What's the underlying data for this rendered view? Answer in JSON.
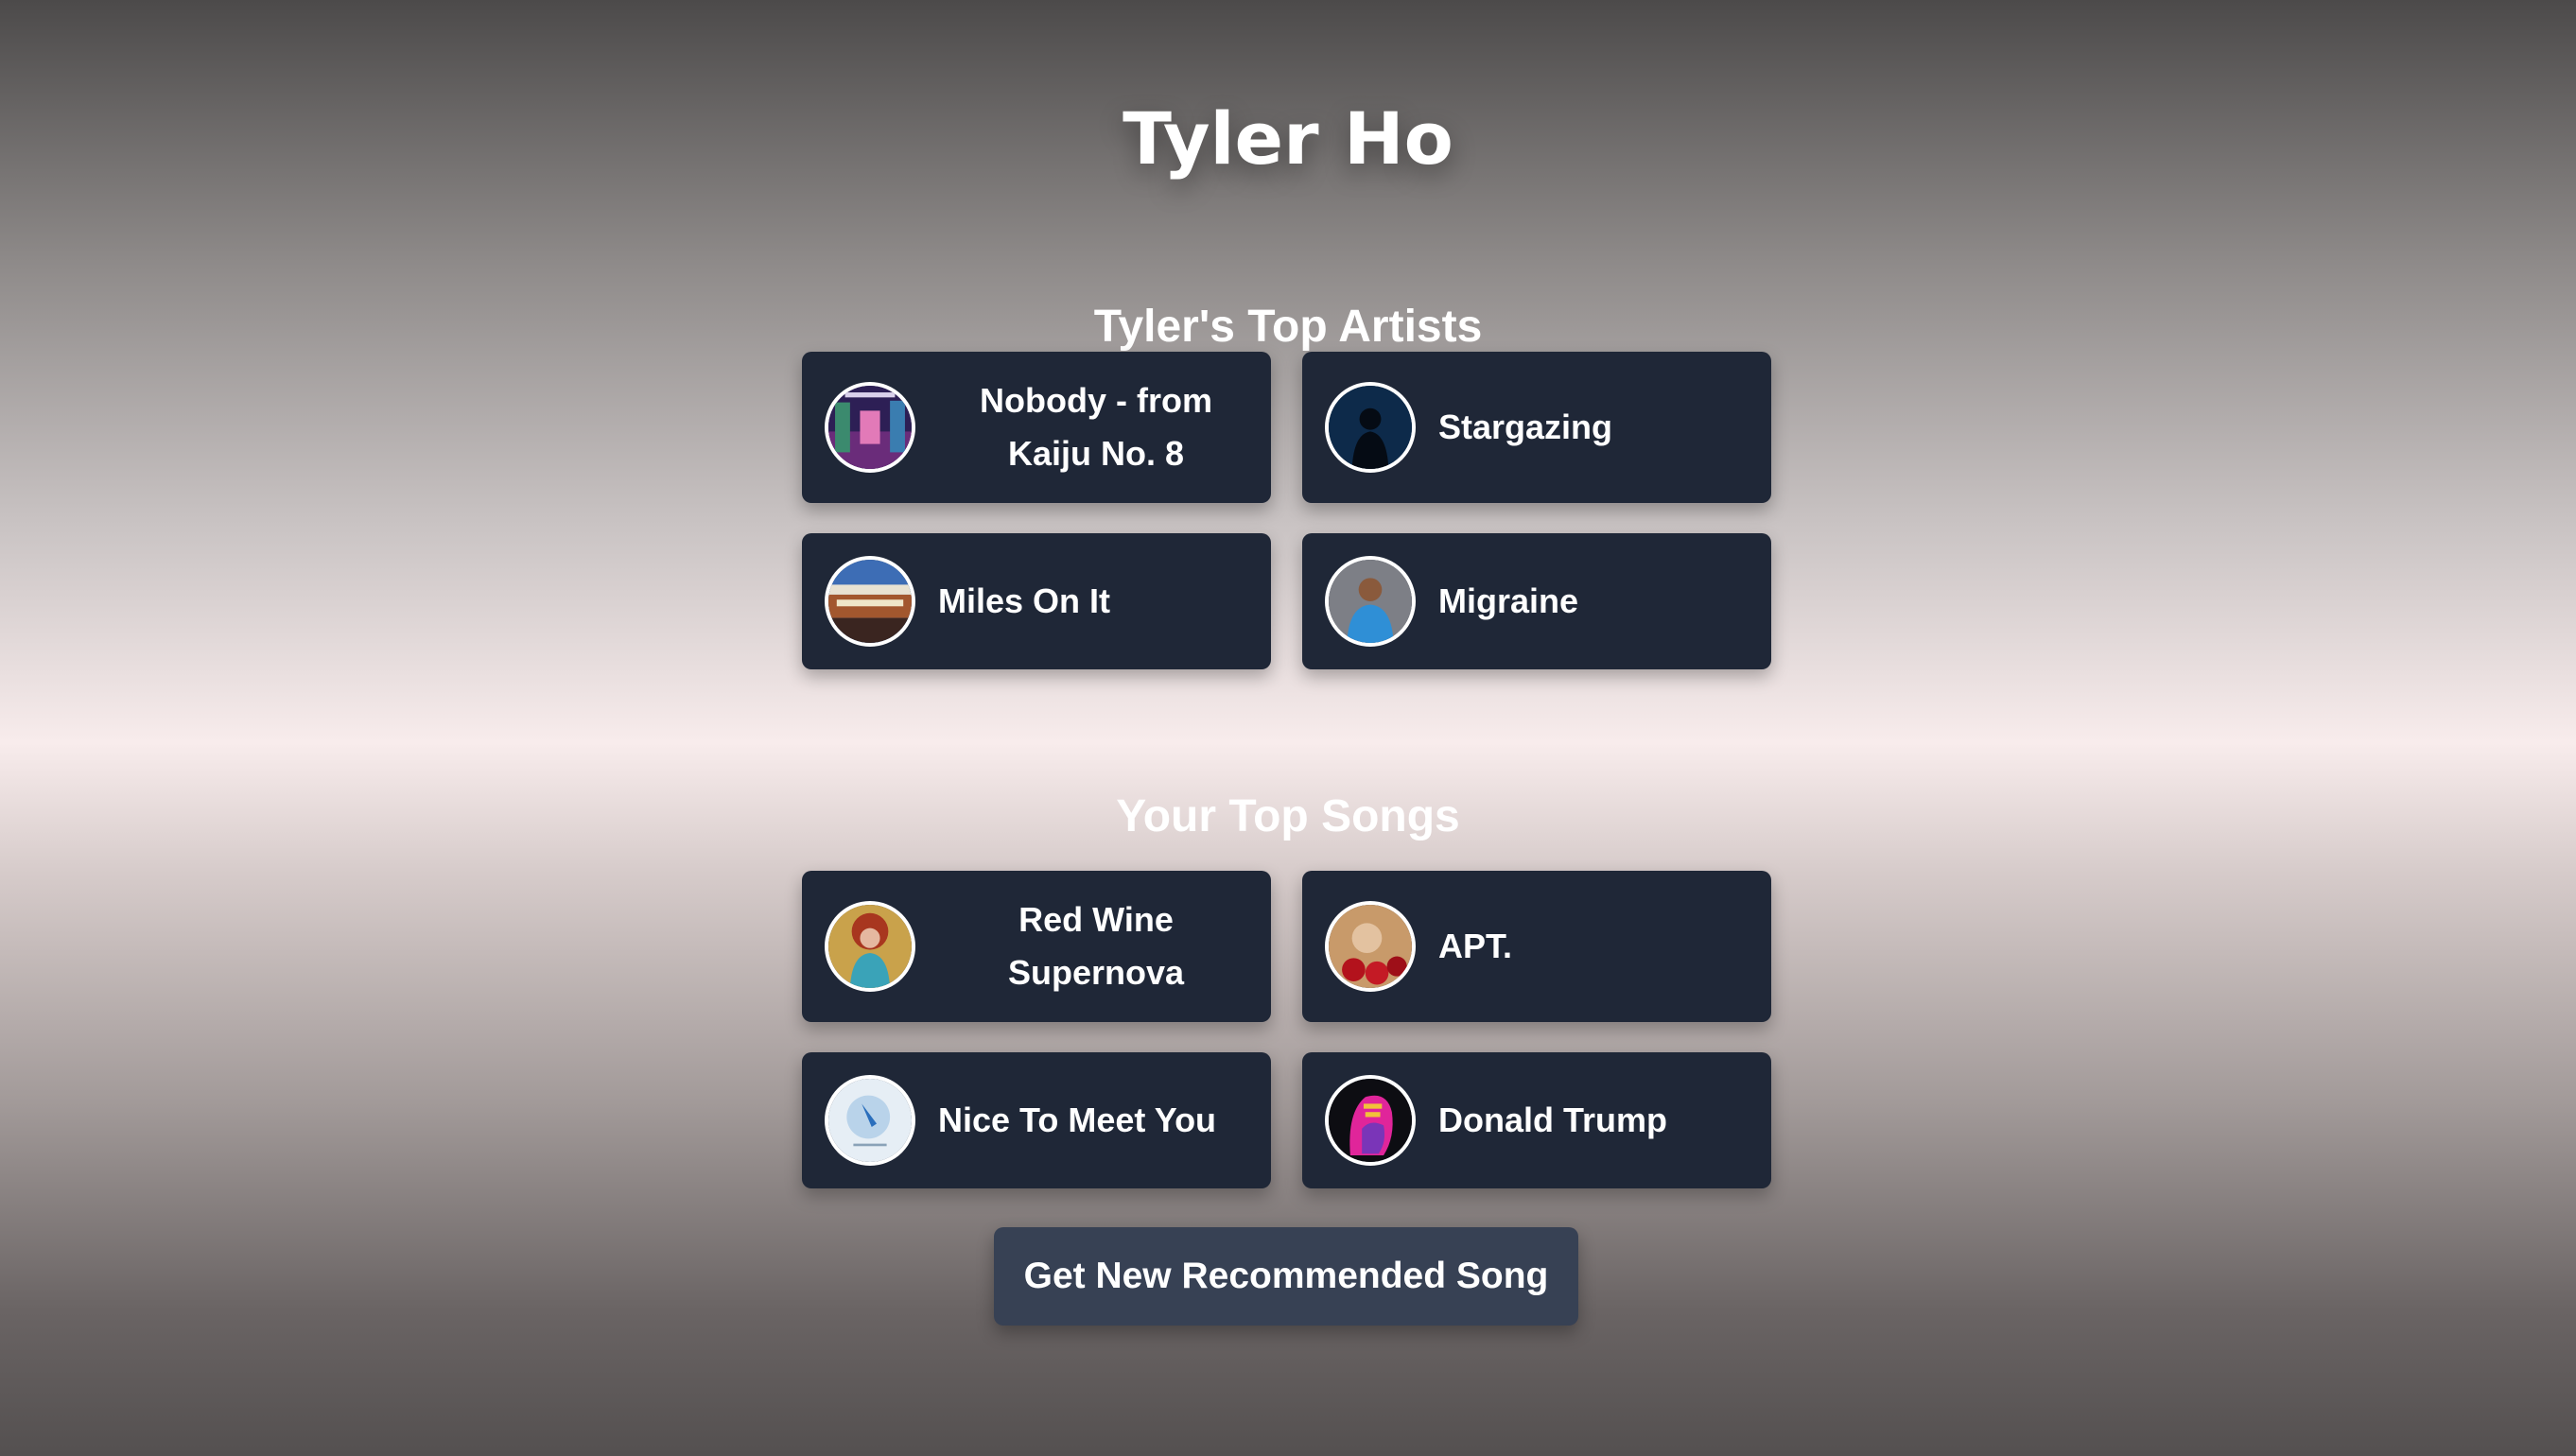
{
  "page": {
    "title": "Tyler Ho"
  },
  "artists_section": {
    "heading": "Tyler's Top Artists",
    "items": [
      {
        "label": "Nobody - from Kaiju No. 8",
        "image": "city-night-album-art"
      },
      {
        "label": "Stargazing",
        "image": "silhouette-album-art"
      },
      {
        "label": "Miles On It",
        "image": "theater-marquee-album-art"
      },
      {
        "label": "Migraine",
        "image": "child-blue-jacket-album-art"
      }
    ]
  },
  "songs_section": {
    "heading": "Your Top Songs",
    "items": [
      {
        "label": "Red Wine Supernova",
        "image": "red-hair-portrait-album-art"
      },
      {
        "label": "APT.",
        "image": "roses-portrait-album-art"
      },
      {
        "label": "Nice To Meet You",
        "image": "pale-blue-album-art"
      },
      {
        "label": "Donald Trump",
        "image": "pink-silhouette-album-art"
      }
    ]
  },
  "actions": {
    "recommend_label": "Get New Recommended Song"
  },
  "colors": {
    "card_bg": "#1f2737",
    "button_bg": "#374154",
    "text": "#ffffff"
  }
}
